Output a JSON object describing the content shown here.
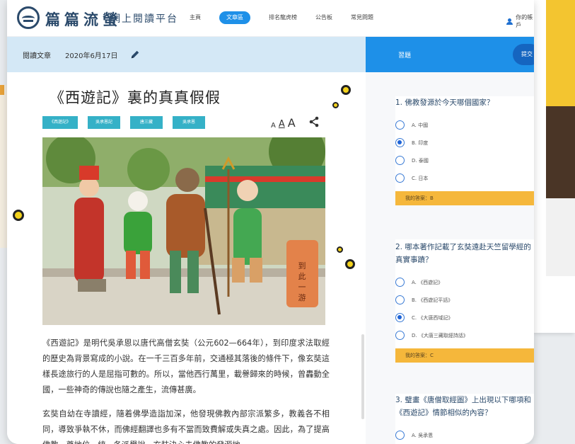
{
  "app": {
    "logo_title": "篇篇流螢",
    "logo_sub": "網上閱讀平台"
  },
  "nav": {
    "items": [
      "主頁",
      "文章區",
      "排名龍虎榜",
      "公告板",
      "常見問題"
    ],
    "active_index": 1,
    "user_label": "你的帳戶"
  },
  "article": {
    "strip_label": "閱讀文章",
    "date": "2020年6月17日",
    "title": "《西遊記》裏的真真假假",
    "tags": [
      "《西遊記》",
      "吳承恩記",
      "唐三藏",
      "吳承恩"
    ],
    "font_sizes": [
      "A",
      "A",
      "A"
    ],
    "paragraphs": [
      "《西遊記》是明代吳承恩以唐代高僧玄奘（公元602—664年），到印度求法取經的歷史為背景寫成的小說。在一千三百多年前，交通極其落後的條件下，像玄奘這樣長途旅行的人是屈指可數的。所以，當他西行萬里，載譽歸來的時候，曾轟動全國，一些神奇的傳說也隨之產生，流傳甚廣。",
      "玄奘自幼在寺讀經，隨着佛學造詣加深，他發現佛教內部宗派繁多，教義各不相同，導致爭執不休，而佛經翻譯也多有不當而致費解或失真之處。因此，為了提高佛教一尊地位，統一各派學說，玄奘決心去佛教的發源地"
    ]
  },
  "quiz": {
    "header_label": "習題",
    "submit_label": "提交",
    "questions": [
      {
        "text": "1. 佛教發源於今天哪個國家？",
        "options": [
          "A. 中國",
          "B. 印度",
          "D. 泰國",
          "C. 日本"
        ],
        "selected": 1,
        "answer": "我的答案：B"
      },
      {
        "text": "2. 哪本著作記載了玄奘遠赴天竺留學經的真實事蹟？",
        "options": [
          "A. 《西遊記》",
          "B. 《西遊記平話》",
          "C. 《大唐西域記》",
          "D. 《大唐三藏取經詩話》"
        ],
        "selected": 2,
        "answer": "我的答案：C"
      },
      {
        "text": "3. 璧畫《唐僧取經圖》上出現以下哪項和《西遊記》情節相似的內容？",
        "options": [
          "A. 吳承恩"
        ],
        "selected": -1,
        "answer": ""
      }
    ]
  },
  "colors": {
    "brand": "#2b4a6b",
    "accent": "#1e90e8",
    "tag": "#35b1c7",
    "answer": "#f5b73b",
    "strip": "#d4e8f6"
  }
}
